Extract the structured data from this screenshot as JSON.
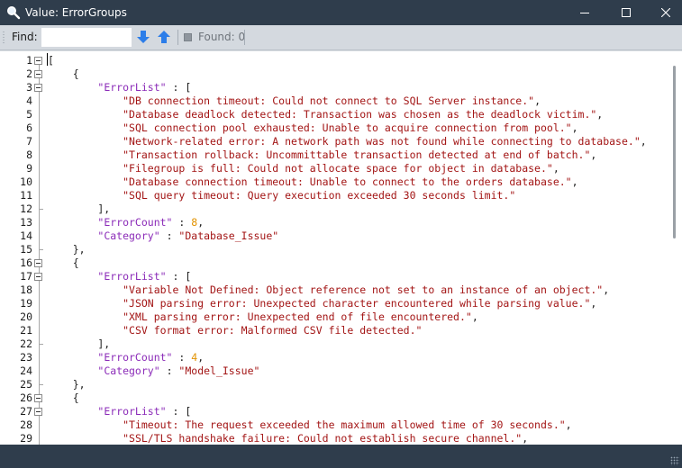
{
  "window": {
    "title": "Value: ErrorGroups",
    "icon": "magnifier-icon",
    "accent_color": "#2f3d4c"
  },
  "toolbar": {
    "find_label": "Find:",
    "find_value": "",
    "find_placeholder": "",
    "find_next_icon": "arrow-down-icon",
    "find_prev_icon": "arrow-up-icon",
    "found_label": "Found: 0"
  },
  "editor": {
    "colors": {
      "punct": "#1e1e1e",
      "key": "#8b2bb8",
      "string": "#a31515",
      "number": "#e29200"
    },
    "lines": [
      {
        "n": "1",
        "tokens": [
          {
            "t": "p",
            "v": "["
          }
        ]
      },
      {
        "n": "2",
        "tokens": [
          {
            "t": "p",
            "v": "    {"
          }
        ]
      },
      {
        "n": "3",
        "tokens": [
          {
            "t": "p",
            "v": "        "
          },
          {
            "t": "k",
            "v": "\"ErrorList\""
          },
          {
            "t": "p",
            "v": " : ["
          }
        ]
      },
      {
        "n": "4",
        "tokens": [
          {
            "t": "p",
            "v": "            "
          },
          {
            "t": "s",
            "v": "\"DB connection timeout: Could not connect to SQL Server instance.\""
          },
          {
            "t": "p",
            "v": ","
          }
        ]
      },
      {
        "n": "5",
        "tokens": [
          {
            "t": "p",
            "v": "            "
          },
          {
            "t": "s",
            "v": "\"Database deadlock detected: Transaction was chosen as the deadlock victim.\""
          },
          {
            "t": "p",
            "v": ","
          }
        ]
      },
      {
        "n": "6",
        "tokens": [
          {
            "t": "p",
            "v": "            "
          },
          {
            "t": "s",
            "v": "\"SQL connection pool exhausted: Unable to acquire connection from pool.\""
          },
          {
            "t": "p",
            "v": ","
          }
        ]
      },
      {
        "n": "7",
        "tokens": [
          {
            "t": "p",
            "v": "            "
          },
          {
            "t": "s",
            "v": "\"Network-related error: A network path was not found while connecting to database.\""
          },
          {
            "t": "p",
            "v": ","
          }
        ]
      },
      {
        "n": "8",
        "tokens": [
          {
            "t": "p",
            "v": "            "
          },
          {
            "t": "s",
            "v": "\"Transaction rollback: Uncommittable transaction detected at end of batch.\""
          },
          {
            "t": "p",
            "v": ","
          }
        ]
      },
      {
        "n": "9",
        "tokens": [
          {
            "t": "p",
            "v": "            "
          },
          {
            "t": "s",
            "v": "\"Filegroup is full: Could not allocate space for object in database.\""
          },
          {
            "t": "p",
            "v": ","
          }
        ]
      },
      {
        "n": "10",
        "tokens": [
          {
            "t": "p",
            "v": "            "
          },
          {
            "t": "s",
            "v": "\"Database connection timeout: Unable to connect to the orders database.\""
          },
          {
            "t": "p",
            "v": ","
          }
        ]
      },
      {
        "n": "11",
        "tokens": [
          {
            "t": "p",
            "v": "            "
          },
          {
            "t": "s",
            "v": "\"SQL query timeout: Query execution exceeded 30 seconds limit.\""
          }
        ]
      },
      {
        "n": "12",
        "tokens": [
          {
            "t": "p",
            "v": "        ],"
          }
        ]
      },
      {
        "n": "13",
        "tokens": [
          {
            "t": "p",
            "v": "        "
          },
          {
            "t": "k",
            "v": "\"ErrorCount\""
          },
          {
            "t": "p",
            "v": " : "
          },
          {
            "t": "n",
            "v": "8"
          },
          {
            "t": "p",
            "v": ","
          }
        ]
      },
      {
        "n": "14",
        "tokens": [
          {
            "t": "p",
            "v": "        "
          },
          {
            "t": "k",
            "v": "\"Category\""
          },
          {
            "t": "p",
            "v": " : "
          },
          {
            "t": "s",
            "v": "\"Database_Issue\""
          }
        ]
      },
      {
        "n": "15",
        "tokens": [
          {
            "t": "p",
            "v": "    },"
          }
        ]
      },
      {
        "n": "16",
        "tokens": [
          {
            "t": "p",
            "v": "    {"
          }
        ]
      },
      {
        "n": "17",
        "tokens": [
          {
            "t": "p",
            "v": "        "
          },
          {
            "t": "k",
            "v": "\"ErrorList\""
          },
          {
            "t": "p",
            "v": " : ["
          }
        ]
      },
      {
        "n": "18",
        "tokens": [
          {
            "t": "p",
            "v": "            "
          },
          {
            "t": "s",
            "v": "\"Variable Not Defined: Object reference not set to an instance of an object.\""
          },
          {
            "t": "p",
            "v": ","
          }
        ]
      },
      {
        "n": "19",
        "tokens": [
          {
            "t": "p",
            "v": "            "
          },
          {
            "t": "s",
            "v": "\"JSON parsing error: Unexpected character encountered while parsing value.\""
          },
          {
            "t": "p",
            "v": ","
          }
        ]
      },
      {
        "n": "20",
        "tokens": [
          {
            "t": "p",
            "v": "            "
          },
          {
            "t": "s",
            "v": "\"XML parsing error: Unexpected end of file encountered.\""
          },
          {
            "t": "p",
            "v": ","
          }
        ]
      },
      {
        "n": "21",
        "tokens": [
          {
            "t": "p",
            "v": "            "
          },
          {
            "t": "s",
            "v": "\"CSV format error: Malformed CSV file detected.\""
          }
        ]
      },
      {
        "n": "22",
        "tokens": [
          {
            "t": "p",
            "v": "        ],"
          }
        ]
      },
      {
        "n": "23",
        "tokens": [
          {
            "t": "p",
            "v": "        "
          },
          {
            "t": "k",
            "v": "\"ErrorCount\""
          },
          {
            "t": "p",
            "v": " : "
          },
          {
            "t": "n",
            "v": "4"
          },
          {
            "t": "p",
            "v": ","
          }
        ]
      },
      {
        "n": "24",
        "tokens": [
          {
            "t": "p",
            "v": "        "
          },
          {
            "t": "k",
            "v": "\"Category\""
          },
          {
            "t": "p",
            "v": " : "
          },
          {
            "t": "s",
            "v": "\"Model_Issue\""
          }
        ]
      },
      {
        "n": "25",
        "tokens": [
          {
            "t": "p",
            "v": "    },"
          }
        ]
      },
      {
        "n": "26",
        "tokens": [
          {
            "t": "p",
            "v": "    {"
          }
        ]
      },
      {
        "n": "27",
        "tokens": [
          {
            "t": "p",
            "v": "        "
          },
          {
            "t": "k",
            "v": "\"ErrorList\""
          },
          {
            "t": "p",
            "v": " : ["
          }
        ]
      },
      {
        "n": "28",
        "tokens": [
          {
            "t": "p",
            "v": "            "
          },
          {
            "t": "s",
            "v": "\"Timeout: The request exceeded the maximum allowed time of 30 seconds.\""
          },
          {
            "t": "p",
            "v": ","
          }
        ]
      },
      {
        "n": "29",
        "tokens": [
          {
            "t": "p",
            "v": "            "
          },
          {
            "t": "s",
            "v": "\"SSL/TLS handshake failure: Could not establish secure channel.\""
          },
          {
            "t": "p",
            "v": ","
          }
        ]
      }
    ]
  }
}
